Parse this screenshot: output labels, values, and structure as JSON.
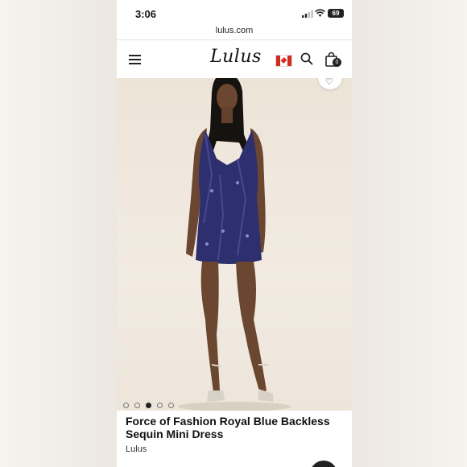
{
  "status_bar": {
    "time": "3:06",
    "battery": "69"
  },
  "browser": {
    "url": "lulus.com"
  },
  "header": {
    "logo": "Lulus",
    "bag_count": "0"
  },
  "product": {
    "title": "Force of Fashion Royal Blue Backless Sequin Mini Dress",
    "brand": "Lulus",
    "image_count": 5,
    "active_image": 3
  },
  "colors": {
    "dress": "#2e2f6e",
    "background": "#ede4d8",
    "skin": "#6b4630"
  }
}
